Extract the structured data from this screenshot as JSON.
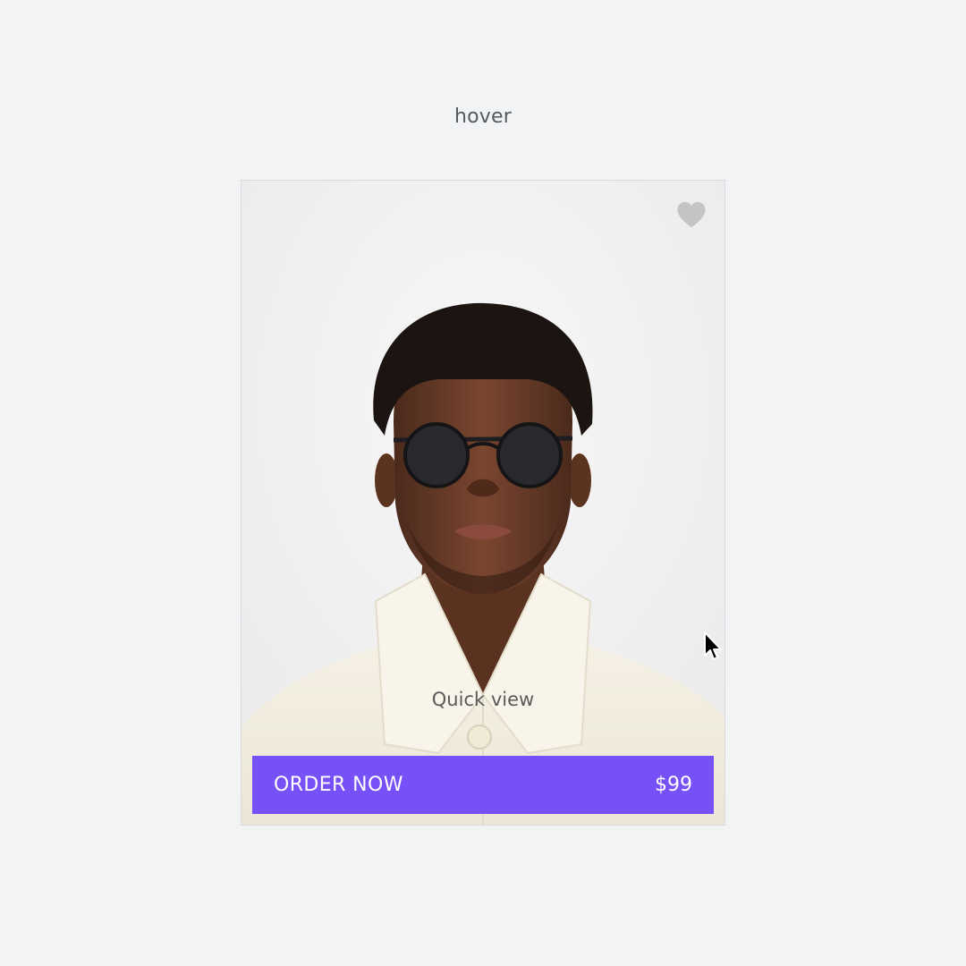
{
  "state_label": "hover",
  "card": {
    "favorite_icon": "heart-icon",
    "quick_view_label": "Quick view",
    "order_label": "ORDER NOW",
    "price": "$99"
  },
  "colors": {
    "background": "#f2f3f5",
    "accent": "#7750f7",
    "heart": "#c4c4c4"
  }
}
